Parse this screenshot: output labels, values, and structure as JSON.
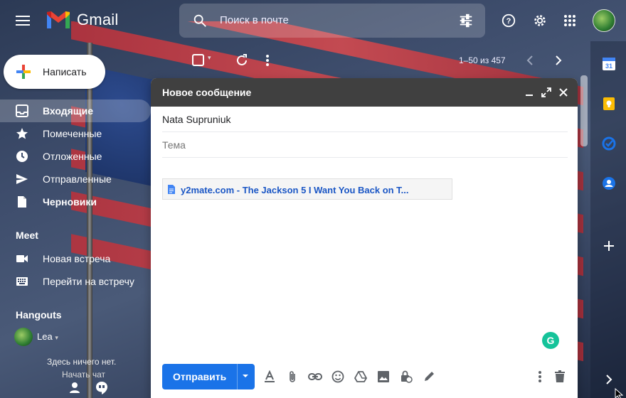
{
  "app": {
    "name": "Gmail"
  },
  "search": {
    "placeholder": "Поиск в почте"
  },
  "compose_button": {
    "label": "Написать"
  },
  "sidebar": {
    "items": [
      {
        "label": "Входящие",
        "icon": "inbox-icon",
        "active": true,
        "bold": true
      },
      {
        "label": "Помеченные",
        "icon": "star-icon"
      },
      {
        "label": "Отложенные",
        "icon": "clock-icon"
      },
      {
        "label": "Отправленные",
        "icon": "send-icon"
      },
      {
        "label": "Черновики",
        "icon": "draft-icon",
        "bold": true
      }
    ],
    "meet_title": "Meet",
    "meet_items": [
      {
        "label": "Новая встреча",
        "icon": "video-icon"
      },
      {
        "label": "Перейти на встречу",
        "icon": "keyboard-icon"
      }
    ],
    "hangouts_title": "Hangouts",
    "hangouts_user": "Lea",
    "hangouts_empty": "Здесь ничего нет.",
    "hangouts_start": "Начать чат"
  },
  "list_toolbar": {
    "pager": "1–50 из 457"
  },
  "compose": {
    "title": "Новое сообщение",
    "to": "Nata Supruniuk",
    "subject_placeholder": "Тема",
    "attachment": "y2mate.com - The Jackson 5 I Want You Back on T...",
    "send_label": "Отправить"
  },
  "colors": {
    "accent": "#1a73e8",
    "compose_header": "#404040",
    "attachment_link": "#1a56c5",
    "grammarly": "#15c39a"
  }
}
